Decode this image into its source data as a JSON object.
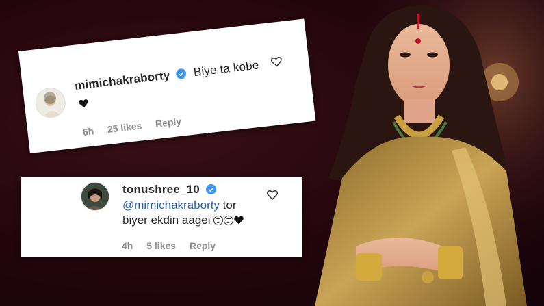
{
  "comments": [
    {
      "username": "mimichakraborty",
      "verified": true,
      "text": "Biye ta kobe",
      "time": "6h",
      "likes": "25 likes",
      "reply": "Reply",
      "icons": [
        "verified-badge-icon",
        "black-heart-emoji",
        "heart-outline-icon"
      ]
    },
    {
      "username": "tonushree_10",
      "verified": true,
      "mention": "@mimichakraborty",
      "text_after_mention": " tor",
      "text_line2": "biyer ekdin aagei",
      "time": "4h",
      "likes": "5 likes",
      "reply": "Reply",
      "icons": [
        "verified-badge-icon",
        "tears-of-joy-emoji",
        "black-heart-emoji",
        "heart-outline-icon"
      ]
    }
  ],
  "colors": {
    "background": "#22060c",
    "verified": "#3897f0",
    "mention": "#2a5db0",
    "meta": "#8e8e8e",
    "saree": "#b08a3c"
  }
}
